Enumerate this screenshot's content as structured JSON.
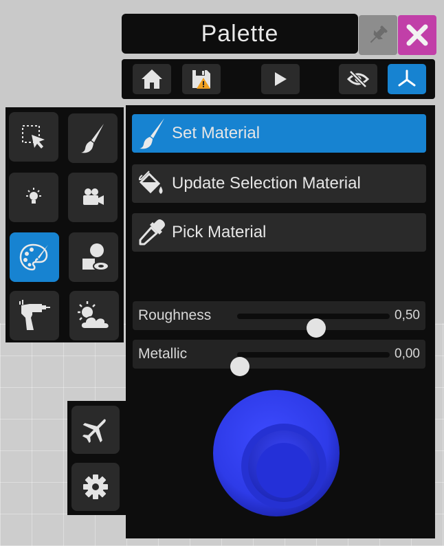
{
  "window": {
    "title": "Palette"
  },
  "toolbar": {
    "buttons": [
      {
        "name": "home",
        "icon": "home-icon"
      },
      {
        "name": "save",
        "icon": "save-warning-icon"
      },
      {
        "name": "play",
        "icon": "play-icon"
      },
      {
        "name": "visibility",
        "icon": "eye-off-icon"
      },
      {
        "name": "gizmo",
        "icon": "axes-icon",
        "active": true
      }
    ]
  },
  "tools": [
    {
      "name": "selection",
      "icon": "select-cursor-icon"
    },
    {
      "name": "paint",
      "icon": "brush-icon"
    },
    {
      "name": "light",
      "icon": "lightbulb-icon"
    },
    {
      "name": "camera",
      "icon": "video-camera-icon"
    },
    {
      "name": "palette",
      "icon": "palette-icon",
      "active": true
    },
    {
      "name": "primitives",
      "icon": "shapes-icon"
    },
    {
      "name": "emitter",
      "icon": "ray-gun-icon"
    },
    {
      "name": "environment",
      "icon": "weather-icon"
    },
    {
      "name": "fly",
      "icon": "airplane-icon"
    },
    {
      "name": "settings",
      "icon": "gear-icon"
    }
  ],
  "actions": [
    {
      "label": "Set Material",
      "icon": "brush-icon",
      "active": true
    },
    {
      "label": "Update Selection Material",
      "icon": "paint-bucket-icon"
    },
    {
      "label": "Pick Material",
      "icon": "eyedropper-icon"
    }
  ],
  "sliders": {
    "roughness": {
      "label": "Roughness",
      "value": 0.5,
      "display": "0,50"
    },
    "metallic": {
      "label": "Metallic",
      "value": 0.0,
      "display": "0,00"
    }
  },
  "colors": {
    "accent": "#1783d1",
    "close": "#c13fa8",
    "panel": "#0d0d0d",
    "button": "#2a2a2a",
    "material_preview": "#2f3cf0"
  }
}
